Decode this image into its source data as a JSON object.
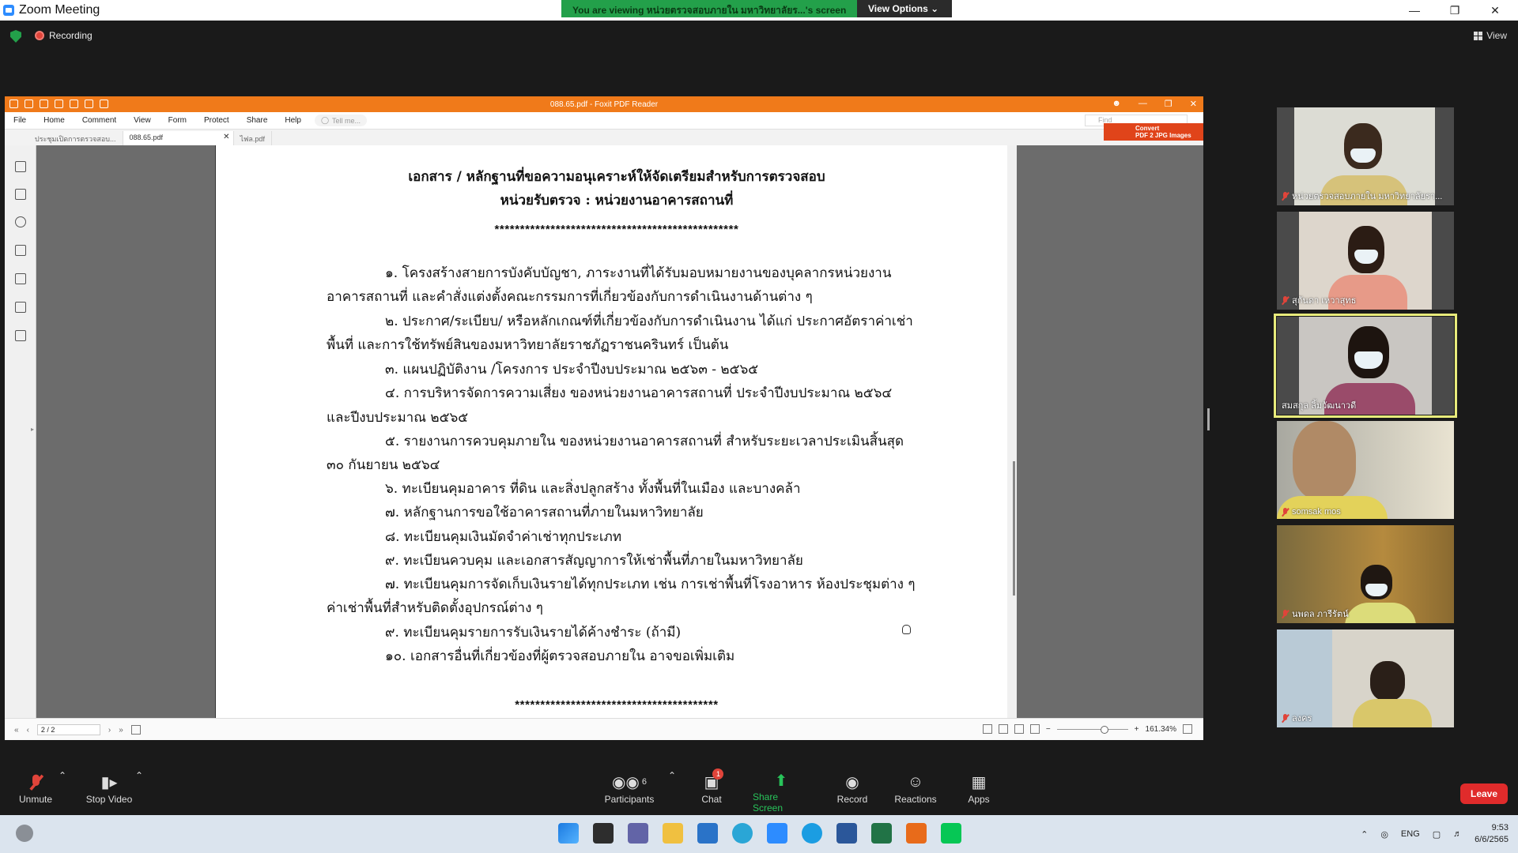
{
  "window": {
    "title": "Zoom Meeting"
  },
  "share_banner": {
    "message": "You are viewing หน่วยตรวจสอบภายใน มหาวิทยาลัยร...'s screen",
    "view_options": "View Options"
  },
  "meeting": {
    "recording_label": "Recording",
    "view_label": "View"
  },
  "foxit": {
    "title": "088.65.pdf - Foxit PDF Reader",
    "menu": [
      "File",
      "Home",
      "Comment",
      "View",
      "Form",
      "Protect",
      "Share",
      "Help"
    ],
    "tell_me": "Tell me...",
    "find_placeholder": "Find",
    "convert": [
      "Convert",
      "PDF 2 JPG Images"
    ],
    "tabs": [
      "ประชุมเปิดการตรวจสอบ...",
      "088.65.pdf",
      "ไฟล.pdf"
    ],
    "page_indicator": "2 / 2",
    "zoom": "161.34%"
  },
  "document": {
    "title_lines": [
      "เอกสาร / หลักฐานที่ขอความอนุเคราะห์ให้จัดเตรียมสำหรับการตรวจสอบ",
      "หน่วยรับตรวจ : หน่วยงานอาคารสถานที่"
    ],
    "stars_top": "************************************************",
    "stars_bottom": "****************************************",
    "lines": [
      "๑. โครงสร้างสายการบังคับบัญชา, ภาระงานที่ได้รับมอบหมายงานของบุคลากรหน่วยงาน",
      "อาคารสถานที่ และคำสั่งแต่งตั้งคณะกรรมการที่เกี่ยวข้องกับการดำเนินงานด้านต่าง ๆ",
      "๒. ประกาศ/ระเบียบ/ หรือหลักเกณฑ์ที่เกี่ยวข้องกับการดำเนินงาน ได้แก่ ประกาศอัตราค่าเช่า",
      "พื้นที่ และการใช้ทรัพย์สินของมหาวิทยาลัยราชภัฏราชนครินทร์  เป็นต้น",
      "๓. แผนปฏิบัติงาน /โครงการ ประจำปีงบประมาณ ๒๕๖๓ - ๒๕๖๕",
      "๔. การบริหารจัดการความเสี่ยง ของหน่วยงานอาคารสถานที่  ประจำปีงบประมาณ  ๒๕๖๔",
      "และปีงบประมาณ ๒๕๖๕",
      "๕. รายงานการควบคุมภายใน ของหน่วยงานอาคารสถานที่ สำหรับระยะเวลาประเมินสิ้นสุด",
      "๓๐ กันยายน  ๒๕๖๔",
      "๖. ทะเบียนคุมอาคาร ที่ดิน และสิ่งปลูกสร้าง ทั้งพื้นที่ในเมือง และบางคล้า",
      "๗. หลักฐานการขอใช้อาคารสถานที่ภายในมหาวิทยาลัย",
      "๘. ทะเบียนคุมเงินมัดจำค่าเช่าทุกประเภท",
      "๙. ทะเบียนควบคุม และเอกสารสัญญาการให้เช่าพื้นที่ภายในมหาวิทยาลัย",
      "๗. ทะเบียนคุมการจัดเก็บเงินรายได้ทุกประเภท เช่น การเช่าพื้นที่โรงอาหาร ห้องประชุมต่าง ๆ",
      "ค่าเช่าพื้นที่สำหรับติดตั้งอุปกรณ์ต่าง ๆ",
      "๙. ทะเบียนคุมรายการรับเงินรายได้ค้างชำระ (ถ้ามี)",
      "๑๐. เอกสารอื่นที่เกี่ยวข้องที่ผู้ตรวจสอบภายใน อาจขอเพิ่มเติม"
    ]
  },
  "participants_gallery": [
    {
      "name": "หน่วยตรวจสอบภายใน มหาวิทยาลัยรา..."
    },
    {
      "name": "สุกันดา เหวาสุทธ"
    },
    {
      "name": "สมสกุล ลิ้มวัฒนาวดี"
    },
    {
      "name": "somsak mos"
    },
    {
      "name": "นพดล ภารีรัตน์"
    },
    {
      "name": "ลงคร"
    }
  ],
  "toolbar": {
    "unmute": "Unmute",
    "stop_video": "Stop Video",
    "participants": "Participants",
    "participants_count": "6",
    "chat": "Chat",
    "chat_badge": "1",
    "share_screen": "Share Screen",
    "record": "Record",
    "reactions": "Reactions",
    "apps": "Apps",
    "leave": "Leave"
  },
  "taskbar": {
    "lang": "ENG",
    "time": "9:53",
    "date": "6/6/2565"
  }
}
